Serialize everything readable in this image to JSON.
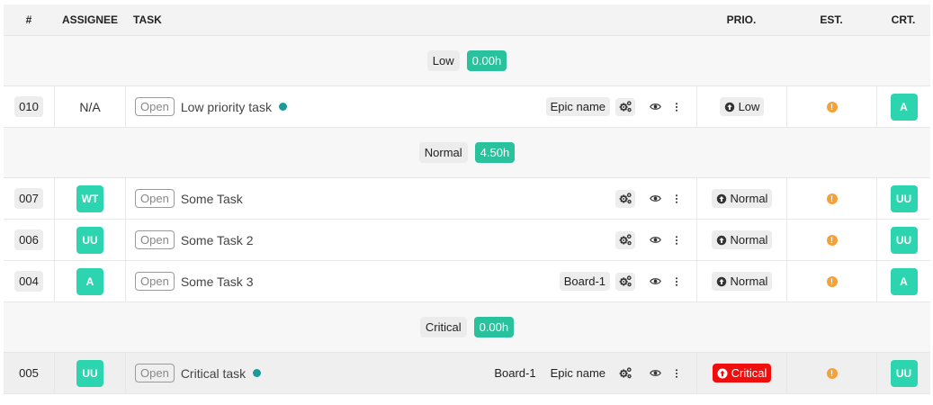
{
  "header": {
    "num": "#",
    "assignee": "ASSIGNEE",
    "task": "TASK",
    "prio": "PRIO.",
    "est": "EST.",
    "crt": "CRT."
  },
  "colors": {
    "accent": "#2dd4b0",
    "hours_badge": "#2ac19d",
    "critical": "#ee0e0e",
    "warning": "#f4a13a",
    "dot": "#1a9a98"
  },
  "groups": [
    {
      "label": "Low",
      "hours": "0.00h"
    },
    {
      "label": "Normal",
      "hours": "4.50h"
    },
    {
      "label": "Critical",
      "hours": "0.00h"
    }
  ],
  "tasks": [
    {
      "num": "010",
      "assignee": "N/A",
      "status": "Open",
      "title": "Low priority task",
      "tags": [
        "Epic name"
      ],
      "prio": "Low",
      "creator": "A"
    },
    {
      "num": "007",
      "assignee": "WT",
      "status": "Open",
      "title": "Some Task",
      "tags": [],
      "prio": "Normal",
      "creator": "UU"
    },
    {
      "num": "006",
      "assignee": "UU",
      "status": "Open",
      "title": "Some Task 2",
      "tags": [],
      "prio": "Normal",
      "creator": "UU"
    },
    {
      "num": "004",
      "assignee": "A",
      "status": "Open",
      "title": "Some Task 3",
      "tags": [
        "Board-1"
      ],
      "prio": "Normal",
      "creator": "A"
    },
    {
      "num": "005",
      "assignee": "UU",
      "status": "Open",
      "title": "Critical task",
      "tags": [
        "Board-1",
        "Epic name"
      ],
      "prio": "Critical",
      "creator": "UU"
    }
  ],
  "icons": {
    "gear": "gears-icon",
    "eye": "eye-icon",
    "kebab": "kebab-menu-icon",
    "prio": "arrow-up-circle-icon",
    "est": "exclamation-circle-icon"
  }
}
